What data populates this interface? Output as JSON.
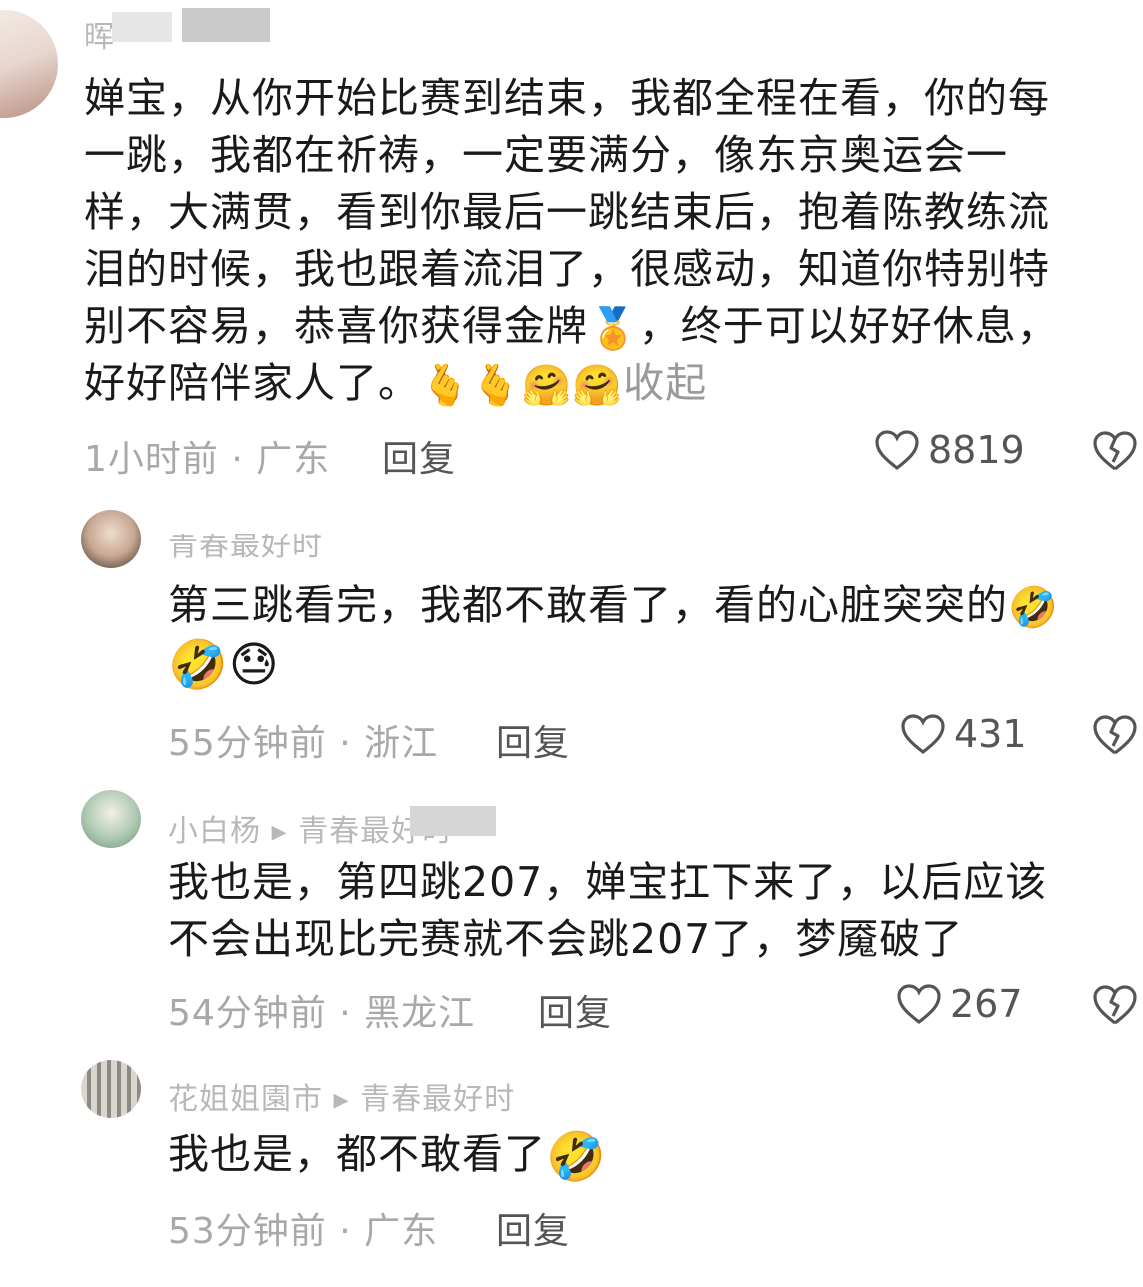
{
  "comments": [
    {
      "username": "晖",
      "lines": [
        "婵宝，从你开始比赛到结束，我都全程在看，你的每",
        "一跳，我都在祈祷，一定要满分，像东京奥运会一",
        "样，大满贯，看到你最后一跳结束后，抱着陈教练流",
        "泪的时候，我也跟着流泪了，很感动，知道你特别特",
        "别不容易，恭喜你获得金牌"
      ],
      "line5_tail": "，终于可以好好休息，",
      "line6": "好好陪伴家人了。",
      "emoji_medal": "🏅",
      "emojis_end": "🫰🫰🤗🤗",
      "collapse_label": "收起",
      "time_location": "1小时前 · 广东",
      "reply_label": "回复",
      "likes": "8819"
    },
    {
      "username": "青春最好时",
      "line1": "第三跳看完，我都不敢看了，看的心脏突突的",
      "line1_emoji": "🤣",
      "line2_emojis": "🤣😓",
      "time_location": "55分钟前 · 浙江",
      "reply_label": "回复",
      "likes": "431"
    },
    {
      "username": "小白杨 ▸ 青春最好时",
      "lines": [
        "我也是，第四跳207，婵宝扛下来了，以后应该",
        "不会出现比完赛就不会跳207了，梦魇破了"
      ],
      "time_location": "54分钟前 · 黑龙江",
      "reply_label": "回复",
      "likes": "267"
    },
    {
      "username": "花姐姐園市 ▸ 青春最好时",
      "line1": "我也是，都不敢看了",
      "line1_emoji": "🤣",
      "time_location": "53分钟前 · 广东",
      "reply_label": "回复"
    }
  ],
  "icons": {
    "like": "heart-outline-icon",
    "dislike": "broken-heart-icon"
  }
}
